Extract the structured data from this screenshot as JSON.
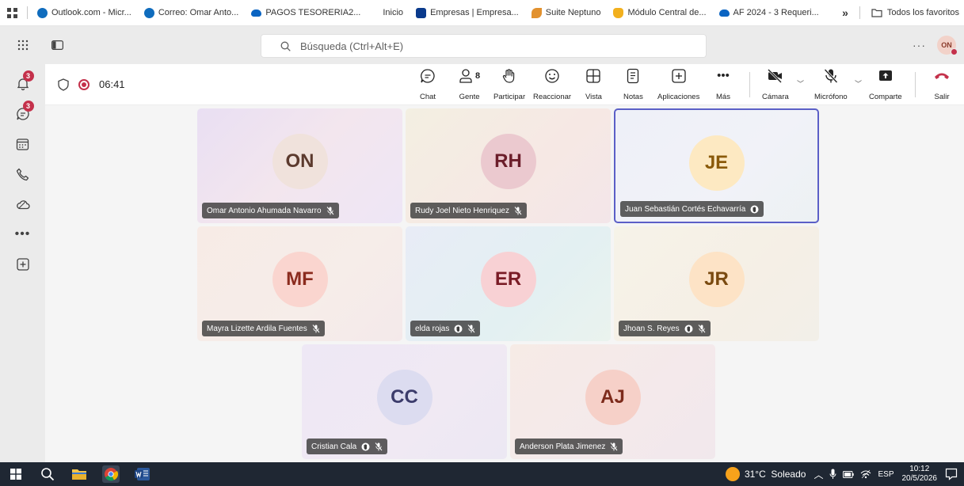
{
  "bookmarks": {
    "items": [
      {
        "label": "Outlook.com - Micr...",
        "icon": "outlook-icon",
        "color": "#0f6cbd"
      },
      {
        "label": "Correo: Omar Anto...",
        "icon": "outlook-icon",
        "color": "#0f6cbd"
      },
      {
        "label": "PAGOS TESORERIA2...",
        "icon": "onedrive-cloud-icon",
        "color": "#0a64c2"
      },
      {
        "label": "Inicio",
        "icon": "",
        "color": ""
      },
      {
        "label": "Empresas | Empresa...",
        "icon": "empresas-logo-icon",
        "color": "#0a3a8c"
      },
      {
        "label": "Suite Neptuno",
        "icon": "feather-icon",
        "color": "#e2912e"
      },
      {
        "label": "Módulo Central de...",
        "icon": "hand-icon",
        "color": "#f2b01e"
      },
      {
        "label": "AF 2024 - 3 Requeri...",
        "icon": "onedrive-cloud-icon",
        "color": "#0a64c2"
      }
    ],
    "overflow": "»",
    "all_favorites": "Todos los favoritos"
  },
  "topbar": {
    "search_placeholder": "Búsqueda (Ctrl+Alt+E)",
    "more": "···",
    "user_initials": "ON"
  },
  "rail": {
    "activity_badge": "3",
    "chat_badge": "3"
  },
  "call": {
    "timer": "06:41",
    "people_count": "8",
    "controls": {
      "chat": "Chat",
      "people": "Gente",
      "raise": "Participar",
      "react": "Reaccionar",
      "view": "Vista",
      "notes": "Notas",
      "apps": "Aplicaciones",
      "more": "Más",
      "camera": "Cámara",
      "mic": "Micrófono",
      "share": "Comparte",
      "leave": "Salir"
    }
  },
  "participants": [
    {
      "initials": "ON",
      "name": "Omar Antonio Ahumada Navarro",
      "muted": true,
      "raised": false,
      "avatar_bg": "#f0e2dc",
      "avatar_fg": "#5c3a2e",
      "tile_bg": "linear-gradient(135deg,#e9dff3 0%,#f3e6ee 50%,#eee6f6 100%)",
      "active": false
    },
    {
      "initials": "RH",
      "name": "Rudy Joel Nieto Henriquez",
      "muted": true,
      "raised": false,
      "avatar_bg": "#ebc9cf",
      "avatar_fg": "#6b1d2a",
      "tile_bg": "linear-gradient(135deg,#f3efe2 0%,#f6e8e4 60%,#f3e6e9 100%)",
      "active": false
    },
    {
      "initials": "JE",
      "name": "Juan Sebastián Cortés Echavarría",
      "muted": false,
      "raised": true,
      "avatar_bg": "#fde9c2",
      "avatar_fg": "#8a5a0a",
      "tile_bg": "linear-gradient(135deg,#eef0f8 0%,#f1f2f8 60%,#ecf1f3 100%)",
      "active": true
    },
    {
      "initials": "MF",
      "name": "Mayra Lizette Ardila Fuentes",
      "muted": true,
      "raised": false,
      "avatar_bg": "#fad5cf",
      "avatar_fg": "#8b2b1e",
      "tile_bg": "linear-gradient(135deg,#f7ebe6 0%,#f6ede9 60%,#f4e9ea 100%)",
      "active": false
    },
    {
      "initials": "ER",
      "name": "elda rojas",
      "muted": true,
      "raised": true,
      "avatar_bg": "#f8d1d4",
      "avatar_fg": "#7a1c26",
      "tile_bg": "linear-gradient(135deg,#e8ecf6 0%,#e3f0f2 60%,#eaf3ee 100%)",
      "active": false
    },
    {
      "initials": "JR",
      "name": "Jhoan S. Reyes",
      "muted": true,
      "raised": true,
      "avatar_bg": "#fde3c6",
      "avatar_fg": "#7a4a10",
      "tile_bg": "linear-gradient(135deg,#f6f3e8 0%,#f5efe6 60%,#f2efe8 100%)",
      "active": false
    },
    {
      "initials": "CC",
      "name": "Cristian Cala",
      "muted": true,
      "raised": true,
      "avatar_bg": "#dcdcf0",
      "avatar_fg": "#3b3b6b",
      "tile_bg": "linear-gradient(135deg,#eee8f5 0%,#f0e9f3 60%,#ece8f3 100%)",
      "active": false
    },
    {
      "initials": "AJ",
      "name": "Anderson Plata Jimenez",
      "muted": true,
      "raised": false,
      "avatar_bg": "#f6d0c8",
      "avatar_fg": "#7d2a1b",
      "tile_bg": "linear-gradient(135deg,#f6ebe6 0%,#f4e9eb 60%,#f1e8ec 100%)",
      "active": false
    }
  ],
  "taskbar": {
    "weather": "31°C  Soleado",
    "language": "ESP",
    "time": "10:12",
    "date": "20/5/2026"
  }
}
